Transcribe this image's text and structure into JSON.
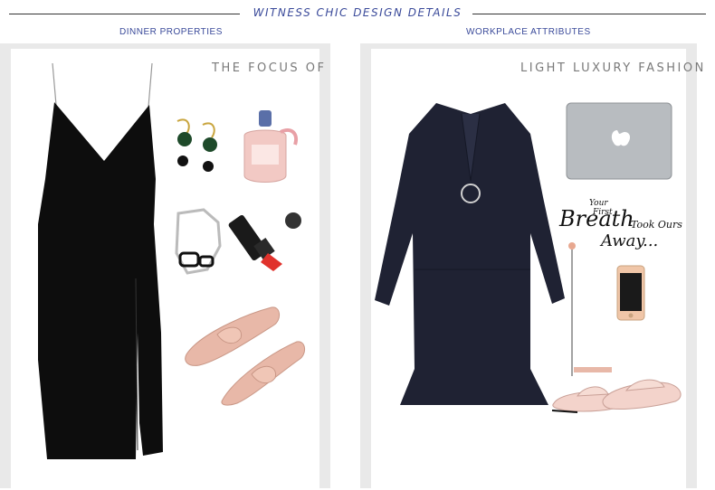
{
  "banner": {
    "title": "WITNESS CHIC DESIGN DETAILS"
  },
  "left": {
    "subtitle": "DINNER   PROPERTIES",
    "heading": "THE FOCUS OF",
    "items": [
      "dress-icon",
      "earrings-icon",
      "perfume-icon",
      "bracelet-icon",
      "lipstick-icon",
      "shoes-icon"
    ]
  },
  "right": {
    "subtitle": "WORKPLACE  ATTRIBUTES",
    "heading": "LIGHT LUXURY  FASHION",
    "quote": {
      "line1": "Your",
      "line2": "First",
      "line3": "Breath",
      "line4": "Took Ours",
      "line5": "Away..."
    },
    "items": [
      "dress-icon",
      "laptop-icon",
      "phone-icon",
      "mules-icon"
    ]
  },
  "colors": {
    "accent": "#3a4a9a",
    "panel": "#e9e9e9",
    "pink": "#e8b8a8"
  }
}
